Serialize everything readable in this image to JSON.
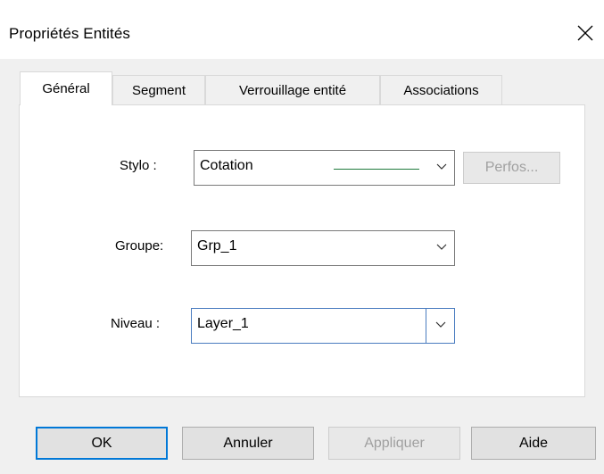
{
  "window": {
    "title": "Propriétés Entités"
  },
  "tabs": [
    {
      "label": "Général",
      "active": true
    },
    {
      "label": "Segment",
      "active": false
    },
    {
      "label": "Verrouillage entité",
      "active": false
    },
    {
      "label": "Associations",
      "active": false
    }
  ],
  "general": {
    "stylo": {
      "label": "Stylo :",
      "value": "Cotation",
      "line_color": "#1f7a3d"
    },
    "perfos_button": "Perfos...",
    "groupe": {
      "label": "Groupe:",
      "value": "Grp_1"
    },
    "niveau": {
      "label": "Niveau :",
      "value": "Layer_1"
    }
  },
  "footer": {
    "ok": "OK",
    "annuler": "Annuler",
    "appliquer": "Appliquer",
    "aide": "Aide"
  },
  "colors": {
    "accent": "#0078d7",
    "disabled_text": "#a0a0a0"
  }
}
